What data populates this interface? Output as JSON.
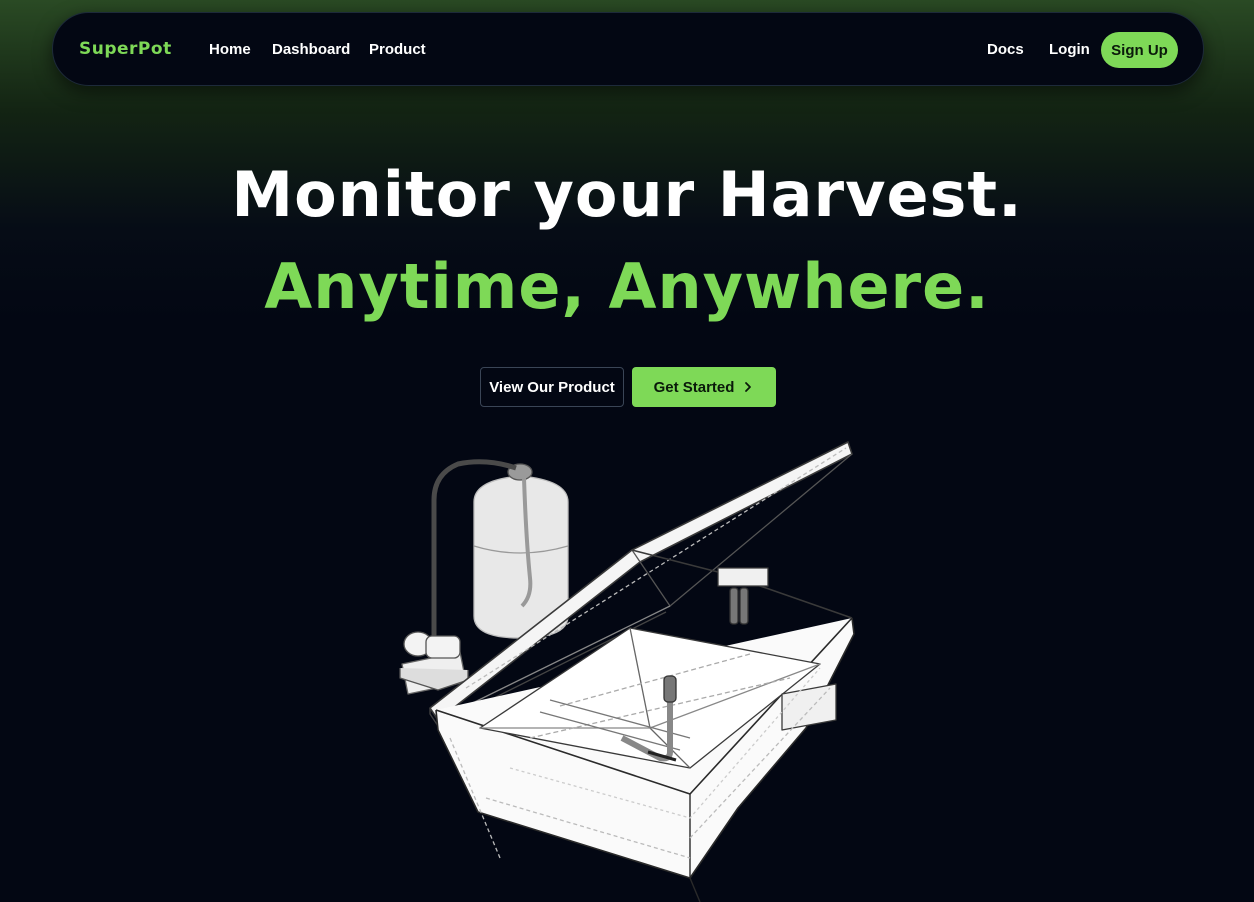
{
  "nav": {
    "brand": "SuperPot",
    "links": [
      {
        "label": "Home"
      },
      {
        "label": "Dashboard"
      },
      {
        "label": "Product"
      }
    ],
    "docs": "Docs",
    "login": "Login",
    "signup": "Sign Up"
  },
  "hero": {
    "line1": "Monitor your Harvest.",
    "line2": "Anytime, Anywhere.",
    "primary_cta": "View Our Product",
    "secondary_cta": "Get Started",
    "secondary_cta_icon": "chevron-right-icon"
  },
  "colors": {
    "accent": "#7ed957",
    "background": "#030713",
    "text": "#ffffff"
  },
  "illustration": {
    "icon": "superpot-device-wireframe"
  }
}
